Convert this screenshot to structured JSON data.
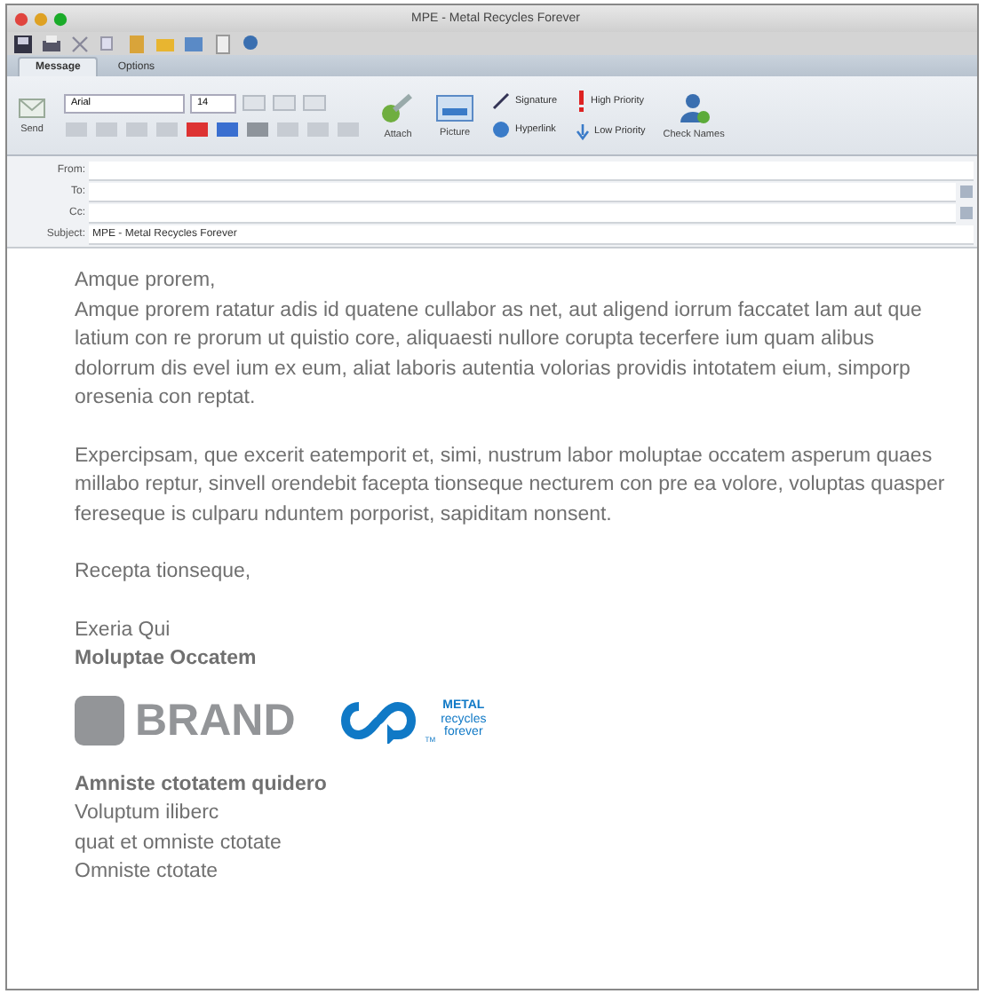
{
  "window": {
    "title": "MPE - Metal Recycles Forever"
  },
  "tabs": [
    {
      "label": "Message",
      "selected": true
    },
    {
      "label": "Options",
      "selected": false
    }
  ],
  "ribbon": {
    "send": "Send",
    "font": "Arial",
    "size": "14",
    "attach": "Attach",
    "picture": "Picture",
    "signature": "Signature",
    "hyperlink": "Hyperlink",
    "high_priority": "High Priority",
    "low_priority": "Low Priority",
    "check_names": "Check Names"
  },
  "fields": [
    {
      "label": "From:"
    },
    {
      "label": "To:"
    },
    {
      "label": "Cc:"
    },
    {
      "label": "Subject:",
      "value": "MPE - Metal Recycles Forever"
    }
  ],
  "body": {
    "paragraphs": [
      [
        "Amque prorem,",
        "Amque prorem ratatur adis id quatene cullabor as net, aut aligend iorrum faccatet lam aut que latium con re prorum ut quistio core, aliquaesti nullore corupta tecerfere ium quam alibus dolorrum dis evel ium ex eum, aliat laboris autentia volorias providis intotatem eium, simporp oresenia con reptat."
      ],
      [
        "Expercipsam, que excerit eatemporit et, simi, nustrum labor moluptae occatem asperum quaes millabo reptur, sinvell orendebit facepta tionseque necturem con pre ea volore, voluptas quasper fereseque is culparu nduntem porporist, sapiditam nonsent."
      ],
      [
        "Recepta tionseque,"
      ]
    ],
    "sender_name": "Exeria Qui",
    "sender_company": "Moluptae Occatem",
    "brand": "BRAND",
    "badge": [
      "METAL",
      "recycles",
      "forever"
    ],
    "trademark": "TM",
    "contact_title": "Amniste ctotatem quidero",
    "contact_lines": [
      "Voluptum iliberc",
      "quat et omniste ctotate",
      "Omniste ctotate"
    ]
  }
}
